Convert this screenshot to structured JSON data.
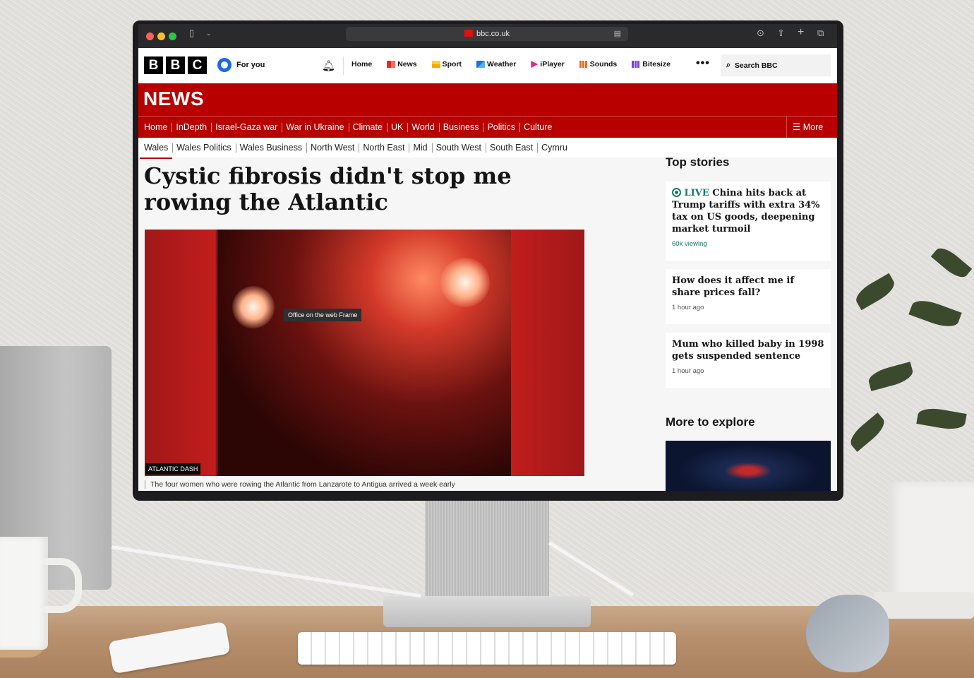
{
  "browser": {
    "url": "bbc.co.uk",
    "colors": {
      "close": "#ff5f57",
      "minimize": "#febc2e",
      "zoom": "#28c840"
    },
    "icons": [
      "sidebar-icon",
      "chevron-down-icon",
      "reader-icon",
      "download-icon",
      "share-icon",
      "new-tab-icon",
      "tabs-icon"
    ]
  },
  "bbc_nav": {
    "logo_letters": [
      "B",
      "B",
      "C"
    ],
    "for_you": "For you",
    "links": [
      {
        "label": "Home",
        "icon": "",
        "color": ""
      },
      {
        "label": "News",
        "icon": "news-icon",
        "color": "#e42b1e"
      },
      {
        "label": "Sport",
        "icon": "sport-icon",
        "color": "#ffd230"
      },
      {
        "label": "Weather",
        "icon": "weather-icon",
        "color": "#1e6fd9"
      },
      {
        "label": "iPlayer",
        "icon": "iplayer-icon",
        "color": "#e6238b"
      },
      {
        "label": "Sounds",
        "icon": "sounds-icon",
        "color": "#f26b21"
      },
      {
        "label": "Bitesize",
        "icon": "bitesize-icon",
        "color": "#7b3fd1"
      }
    ],
    "more": "•••",
    "search_label": "Search BBC"
  },
  "news": {
    "logo": "NEWS",
    "accent": "#b80000",
    "sections": [
      "Home",
      "InDepth",
      "Israel-Gaza war",
      "War in Ukraine",
      "Climate",
      "UK",
      "World",
      "Business",
      "Politics",
      "Culture"
    ],
    "active_section": "UK",
    "more_label": "More",
    "subsections": [
      "Wales",
      "Wales Politics",
      "Wales Business",
      "North West",
      "North East",
      "Mid",
      "South West",
      "South East",
      "Cymru"
    ],
    "active_subsection": "Wales"
  },
  "article": {
    "headline": "Cystic fibrosis didn't stop me rowing the Atlantic",
    "image_tooltip": "Office on the web Frame",
    "image_credit": "ATLANTIC DASH",
    "caption": "The four women who were rowing the Atlantic from Lanzarote to Antigua arrived a week early"
  },
  "sidebar": {
    "top_stories_title": "Top stories",
    "stories": [
      {
        "live": "LIVE",
        "title": "China hits back at Trump tariffs with extra 34% tax on US goods, deepening market turmoil",
        "meta": "60k viewing"
      },
      {
        "live": "",
        "title": "How does it affect me if share prices fall?",
        "meta": "1 hour ago"
      },
      {
        "live": "",
        "title": "Mum who killed baby in 1998 gets suspended sentence",
        "meta": "1 hour ago"
      }
    ],
    "more_to_explore_title": "More to explore"
  }
}
